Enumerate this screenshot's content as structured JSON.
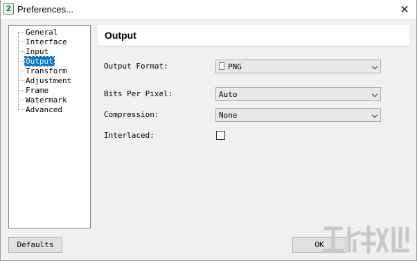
{
  "window": {
    "title": "Preferences...",
    "icon": "preferences-app-icon",
    "icon_text": "2",
    "close_glyph": "✕"
  },
  "tree": {
    "items": [
      {
        "label": "General"
      },
      {
        "label": "Interface"
      },
      {
        "label": "Input"
      },
      {
        "label": "Output"
      },
      {
        "label": "Transform"
      },
      {
        "label": "Adjustment"
      },
      {
        "label": "Frame"
      },
      {
        "label": "Watermark"
      },
      {
        "label": "Advanced"
      }
    ],
    "selected": "Output"
  },
  "panel": {
    "title": "Output",
    "output_format": {
      "label": "Output Format:",
      "value": "PNG"
    },
    "bits_per_pixel": {
      "label": "Bits Per Pixel:",
      "value": "Auto"
    },
    "compression": {
      "label": "Compression:",
      "value": "None"
    },
    "interlaced": {
      "label": "Interlaced:",
      "checked": false
    }
  },
  "buttons": {
    "defaults": "Defaults",
    "ok": "OK"
  },
  "colors": {
    "selection": "#0078d7",
    "window_bg": "#f0f0f0"
  }
}
